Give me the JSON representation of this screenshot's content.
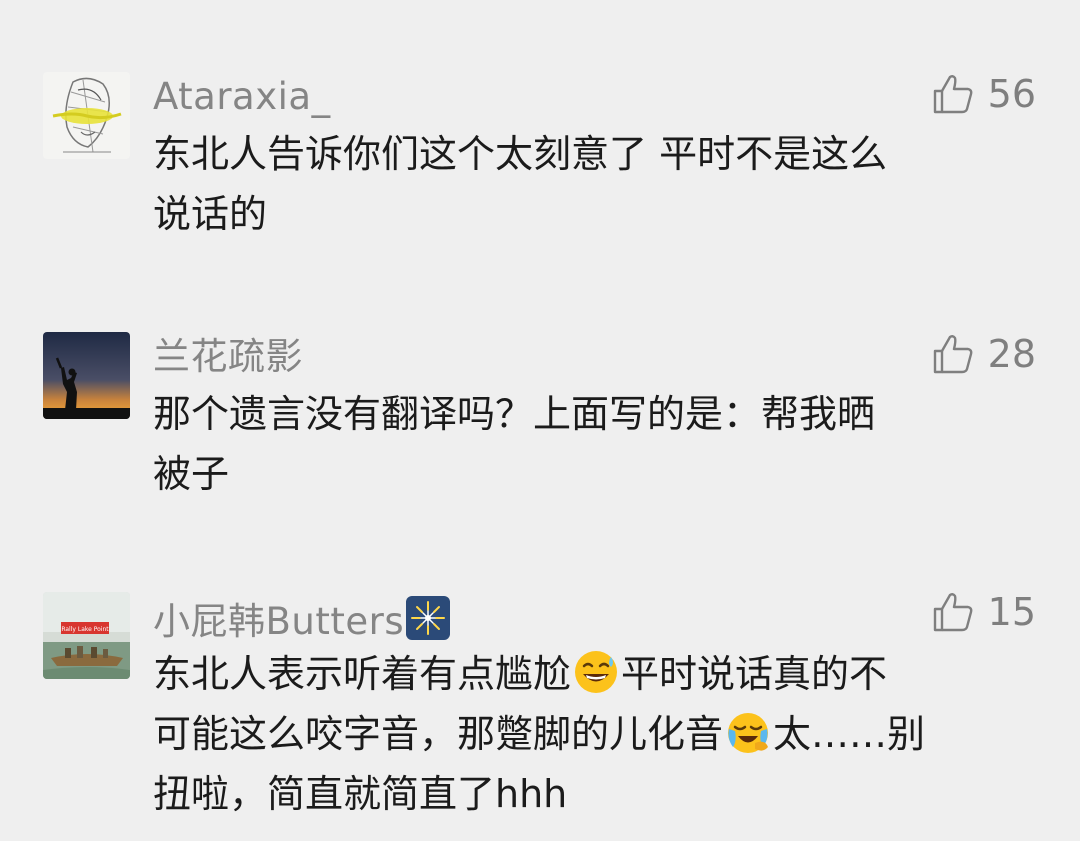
{
  "comments": [
    {
      "username": "Ataraxia_",
      "likes": "56",
      "avatar_icon": "sketch-portrait-avatar",
      "text": "东北人告诉你们这个太刻意了 平时不是这么\n说话的"
    },
    {
      "username": "兰花疏影",
      "likes": "28",
      "avatar_icon": "sunset-silhouette-avatar",
      "text": "那个遗言没有翻译吗？上面写的是：帮我晒\n被子"
    },
    {
      "username": "小屁韩Butters",
      "username_emoji": "sparkler-emoji",
      "likes": "15",
      "avatar_icon": "boat-landscape-avatar",
      "avatar_sign_text": "Rally Lake Point",
      "text_part1": "东北人表示听着有点尴尬",
      "emoji1": "grinning-sweat-emoji",
      "text_part2": "平时说话真的不\n可能这么咬字音，那蹩脚的儿化音",
      "emoji2": "loudly-crying-laughing-emoji",
      "text_part3": "太……别\n扭啦，简直就简直了hhh"
    }
  ]
}
